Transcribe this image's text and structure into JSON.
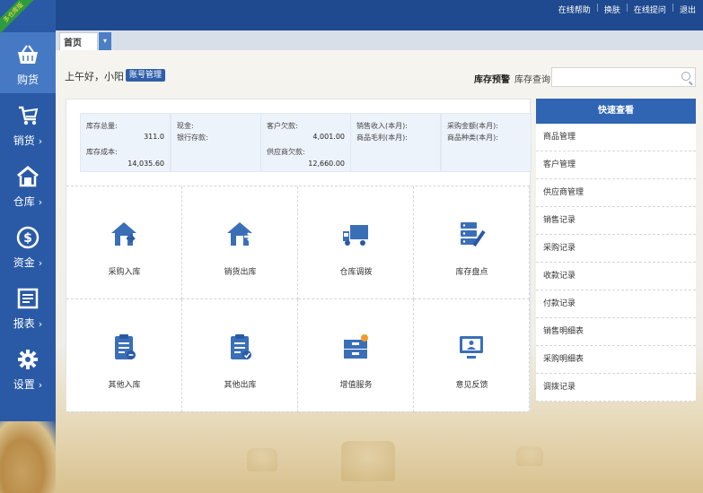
{
  "ribbon": "多仓库版",
  "top_links": [
    "在线帮助",
    "换肤",
    "在线提问",
    "退出"
  ],
  "sidebar": [
    {
      "label": "购货",
      "icon": "basket-icon",
      "arrow": ""
    },
    {
      "label": "销货",
      "icon": "cart-icon",
      "arrow": "›"
    },
    {
      "label": "仓库",
      "icon": "warehouse-icon",
      "arrow": "›"
    },
    {
      "label": "资金",
      "icon": "dollar-coin-icon",
      "arrow": "›"
    },
    {
      "label": "报表",
      "icon": "report-icon",
      "arrow": "›"
    },
    {
      "label": "设置",
      "icon": "gear-icon",
      "arrow": "›"
    }
  ],
  "tab": {
    "label": "首页"
  },
  "greeting": "上午好，小阳",
  "account_button": "账号管理",
  "stock_warning": "库存预警",
  "stock_query": "库存查询",
  "search": {
    "placeholder": ""
  },
  "stats": [
    {
      "label1": "库存总量:",
      "value1": "311.0",
      "label2": "库存成本:",
      "value2": "14,035.60"
    },
    {
      "label1": "现金:",
      "value1": "",
      "label2": "银行存款:",
      "value2": ""
    },
    {
      "label1": "客户欠款:",
      "value1": "4,001.00",
      "label2": "供应商欠款:",
      "value2": "12,660.00"
    },
    {
      "label1": "销售收入(本月):",
      "value1": "",
      "label2": "商品毛利(本月):",
      "value2": ""
    },
    {
      "label1": "采购金额(本月):",
      "value1": "",
      "label2": "商品种类(本月):",
      "value2": ""
    }
  ],
  "actions": [
    {
      "label": "采购入库",
      "icon": "purchase-in-icon"
    },
    {
      "label": "销货出库",
      "icon": "sales-out-icon"
    },
    {
      "label": "仓库调拨",
      "icon": "truck-icon"
    },
    {
      "label": "库存盘点",
      "icon": "inventory-check-icon"
    },
    {
      "label": "其他入库",
      "icon": "other-in-icon"
    },
    {
      "label": "其他出库",
      "icon": "other-out-icon"
    },
    {
      "label": "增值服务",
      "icon": "value-service-icon"
    },
    {
      "label": "意见反馈",
      "icon": "feedback-icon"
    }
  ],
  "quick_view": {
    "title": "快速查看",
    "items": [
      "商品管理",
      "客户管理",
      "供应商管理",
      "销售记录",
      "采购记录",
      "收款记录",
      "付款记录",
      "销售明细表",
      "采购明细表",
      "调拨记录"
    ]
  },
  "colors": {
    "sidebar": "#2a5aa6",
    "topbar": "#1f4a8f",
    "accent": "#2f65b3",
    "icon": "#3a6fb8"
  }
}
